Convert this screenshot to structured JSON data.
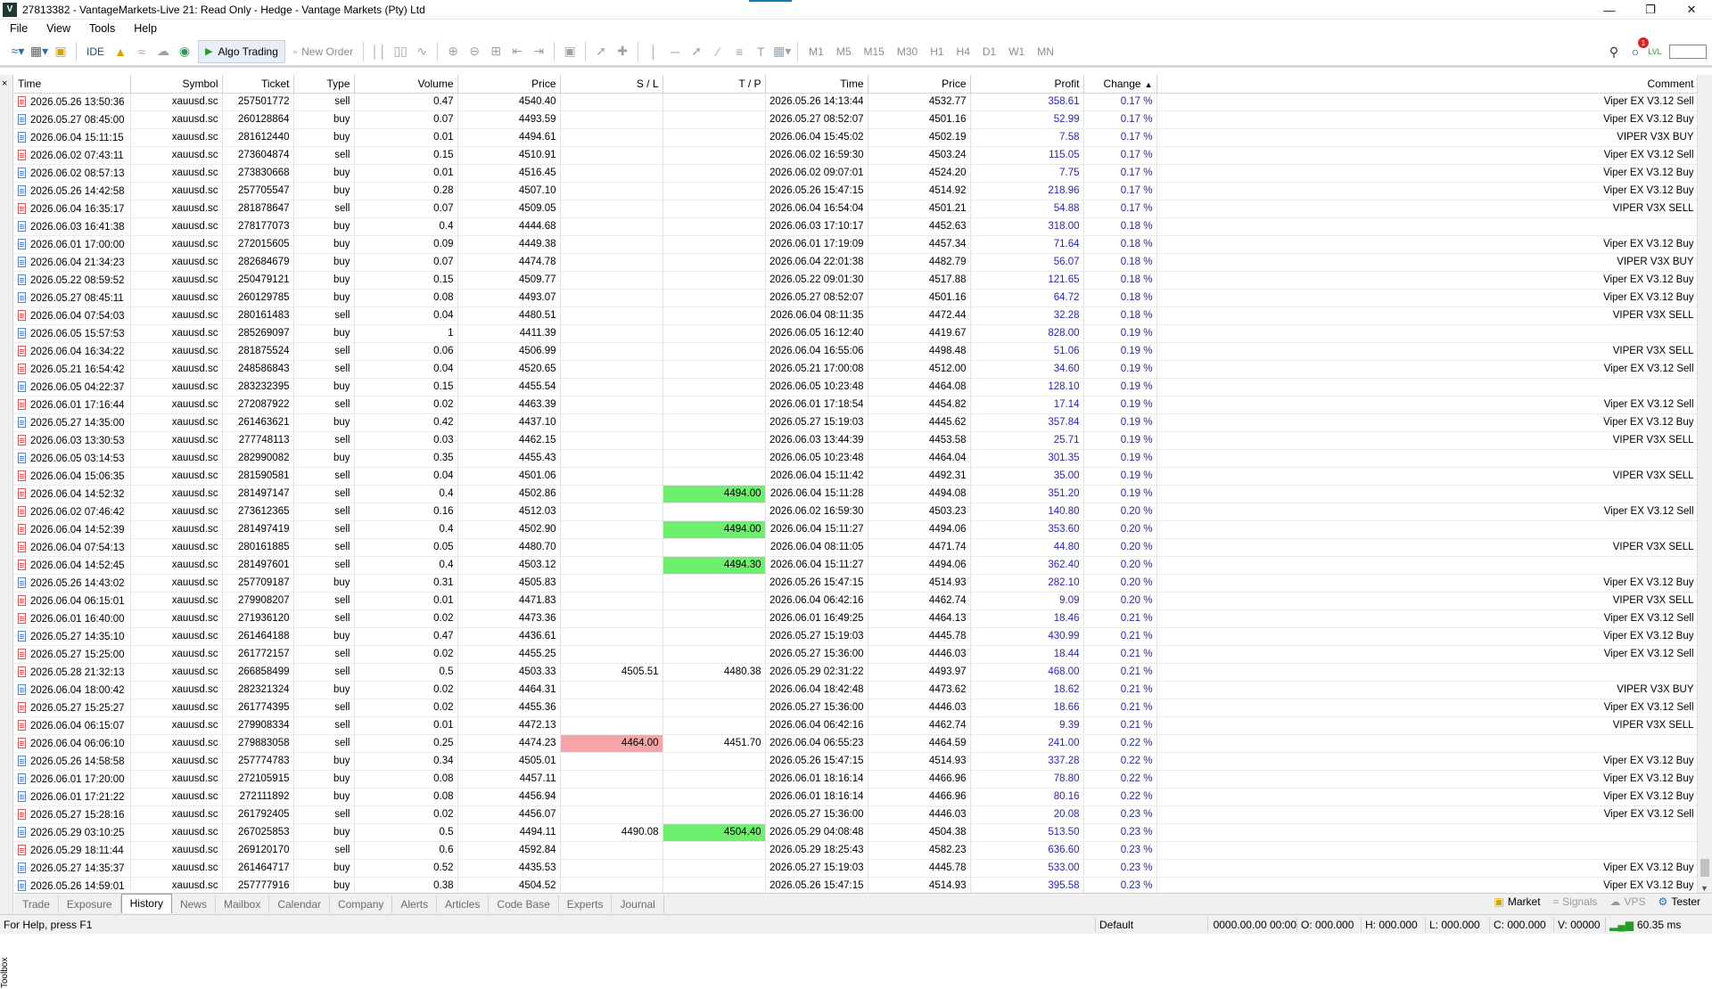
{
  "window": {
    "title": "27813382 - VantageMarkets-Live 21: Read Only - Hedge - Vantage Markets (Pty) Ltd",
    "app_icon": "V"
  },
  "menu": [
    "File",
    "View",
    "Tools",
    "Help"
  ],
  "toolbar": {
    "ide_label": "IDE",
    "algo_trading_label": "Algo Trading",
    "new_order_label": "New Order",
    "timeframes": [
      "M1",
      "M5",
      "M15",
      "M30",
      "H1",
      "H4",
      "D1",
      "W1",
      "MN"
    ],
    "notification_count": "1",
    "lvl_label": "LVL"
  },
  "toolbox": {
    "label": "Toolbox",
    "close": "×"
  },
  "table": {
    "columns": [
      "Time",
      "Symbol",
      "Ticket",
      "Type",
      "Volume",
      "Price",
      "S / L",
      "T / P",
      "Time",
      "Price",
      "Profit",
      "Change",
      "Comment"
    ],
    "sort_indicator": "▲",
    "rows": [
      [
        "2026.05.26 13:50:36",
        "xauusd.sc",
        "257501772",
        "sell",
        "0.47",
        "4540.40",
        "",
        "",
        "2026.05.26 14:13:44",
        "4532.77",
        "358.61",
        "0.17 %",
        "Viper EX V3.12 Sell"
      ],
      [
        "2026.05.27 08:45:00",
        "xauusd.sc",
        "260128864",
        "buy",
        "0.07",
        "4493.59",
        "",
        "",
        "2026.05.27 08:52:07",
        "4501.16",
        "52.99",
        "0.17 %",
        "Viper EX V3.12 Buy"
      ],
      [
        "2026.06.04 15:11:15",
        "xauusd.sc",
        "281612440",
        "buy",
        "0.01",
        "4494.61",
        "",
        "",
        "2026.06.04 15:45:02",
        "4502.19",
        "7.58",
        "0.17 %",
        "VIPER V3X BUY"
      ],
      [
        "2026.06.02 07:43:11",
        "xauusd.sc",
        "273604874",
        "sell",
        "0.15",
        "4510.91",
        "",
        "",
        "2026.06.02 16:59:30",
        "4503.24",
        "115.05",
        "0.17 %",
        "Viper EX V3.12 Sell"
      ],
      [
        "2026.06.02 08:57:13",
        "xauusd.sc",
        "273830668",
        "buy",
        "0.01",
        "4516.45",
        "",
        "",
        "2026.06.02 09:07:01",
        "4524.20",
        "7.75",
        "0.17 %",
        "Viper EX V3.12 Buy"
      ],
      [
        "2026.05.26 14:42:58",
        "xauusd.sc",
        "257705547",
        "buy",
        "0.28",
        "4507.10",
        "",
        "",
        "2026.05.26 15:47:15",
        "4514.92",
        "218.96",
        "0.17 %",
        "Viper EX V3.12 Buy"
      ],
      [
        "2026.06.04 16:35:17",
        "xauusd.sc",
        "281878647",
        "sell",
        "0.07",
        "4509.05",
        "",
        "",
        "2026.06.04 16:54:04",
        "4501.21",
        "54.88",
        "0.17 %",
        "VIPER V3X SELL"
      ],
      [
        "2026.06.03 16:41:38",
        "xauusd.sc",
        "278177073",
        "buy",
        "0.4",
        "4444.68",
        "",
        "",
        "2026.06.03 17:10:17",
        "4452.63",
        "318.00",
        "0.18 %",
        ""
      ],
      [
        "2026.06.01 17:00:00",
        "xauusd.sc",
        "272015605",
        "buy",
        "0.09",
        "4449.38",
        "",
        "",
        "2026.06.01 17:19:09",
        "4457.34",
        "71.64",
        "0.18 %",
        "Viper EX V3.12 Buy"
      ],
      [
        "2026.06.04 21:34:23",
        "xauusd.sc",
        "282684679",
        "buy",
        "0.07",
        "4474.78",
        "",
        "",
        "2026.06.04 22:01:38",
        "4482.79",
        "56.07",
        "0.18 %",
        "VIPER V3X BUY"
      ],
      [
        "2026.05.22 08:59:52",
        "xauusd.sc",
        "250479121",
        "buy",
        "0.15",
        "4509.77",
        "",
        "",
        "2026.05.22 09:01:30",
        "4517.88",
        "121.65",
        "0.18 %",
        "Viper EX V3.12 Buy"
      ],
      [
        "2026.05.27 08:45:11",
        "xauusd.sc",
        "260129785",
        "buy",
        "0.08",
        "4493.07",
        "",
        "",
        "2026.05.27 08:52:07",
        "4501.16",
        "64.72",
        "0.18 %",
        "Viper EX V3.12 Buy"
      ],
      [
        "2026.06.04 07:54:03",
        "xauusd.sc",
        "280161483",
        "sell",
        "0.04",
        "4480.51",
        "",
        "",
        "2026.06.04 08:11:35",
        "4472.44",
        "32.28",
        "0.18 %",
        "VIPER V3X SELL"
      ],
      [
        "2026.06.05 15:57:53",
        "xauusd.sc",
        "285269097",
        "buy",
        "1",
        "4411.39",
        "",
        "",
        "2026.06.05 16:12:40",
        "4419.67",
        "828.00",
        "0.19 %",
        ""
      ],
      [
        "2026.06.04 16:34:22",
        "xauusd.sc",
        "281875524",
        "sell",
        "0.06",
        "4506.99",
        "",
        "",
        "2026.06.04 16:55:06",
        "4498.48",
        "51.06",
        "0.19 %",
        "VIPER V3X SELL"
      ],
      [
        "2026.05.21 16:54:42",
        "xauusd.sc",
        "248586843",
        "sell",
        "0.04",
        "4520.65",
        "",
        "",
        "2026.05.21 17:00:08",
        "4512.00",
        "34.60",
        "0.19 %",
        "Viper EX V3.12 Sell"
      ],
      [
        "2026.06.05 04:22:37",
        "xauusd.sc",
        "283232395",
        "buy",
        "0.15",
        "4455.54",
        "",
        "",
        "2026.06.05 10:23:48",
        "4464.08",
        "128.10",
        "0.19 %",
        ""
      ],
      [
        "2026.06.01 17:16:44",
        "xauusd.sc",
        "272087922",
        "sell",
        "0.02",
        "4463.39",
        "",
        "",
        "2026.06.01 17:18:54",
        "4454.82",
        "17.14",
        "0.19 %",
        "Viper EX V3.12 Sell"
      ],
      [
        "2026.05.27 14:35:00",
        "xauusd.sc",
        "261463621",
        "buy",
        "0.42",
        "4437.10",
        "",
        "",
        "2026.05.27 15:19:03",
        "4445.62",
        "357.84",
        "0.19 %",
        "Viper EX V3.12 Buy"
      ],
      [
        "2026.06.03 13:30:53",
        "xauusd.sc",
        "277748113",
        "sell",
        "0.03",
        "4462.15",
        "",
        "",
        "2026.06.03 13:44:39",
        "4453.58",
        "25.71",
        "0.19 %",
        "VIPER V3X SELL"
      ],
      [
        "2026.06.05 03:14:53",
        "xauusd.sc",
        "282990082",
        "buy",
        "0.35",
        "4455.43",
        "",
        "",
        "2026.06.05 10:23:48",
        "4464.04",
        "301.35",
        "0.19 %",
        ""
      ],
      [
        "2026.06.04 15:06:35",
        "xauusd.sc",
        "281590581",
        "sell",
        "0.04",
        "4501.06",
        "",
        "",
        "2026.06.04 15:11:42",
        "4492.31",
        "35.00",
        "0.19 %",
        "VIPER V3X SELL"
      ],
      [
        "2026.06.04 14:52:32",
        "xauusd.sc",
        "281497147",
        "sell",
        "0.4",
        "4502.86",
        "",
        "4494.00",
        "2026.06.04 15:11:28",
        "4494.08",
        "351.20",
        "0.19 %",
        ""
      ],
      [
        "2026.06.02 07:46:42",
        "xauusd.sc",
        "273612365",
        "sell",
        "0.16",
        "4512.03",
        "",
        "",
        "2026.06.02 16:59:30",
        "4503.23",
        "140.80",
        "0.20 %",
        "Viper EX V3.12 Sell"
      ],
      [
        "2026.06.04 14:52:39",
        "xauusd.sc",
        "281497419",
        "sell",
        "0.4",
        "4502.90",
        "",
        "4494.00",
        "2026.06.04 15:11:27",
        "4494.06",
        "353.60",
        "0.20 %",
        ""
      ],
      [
        "2026.06.04 07:54:13",
        "xauusd.sc",
        "280161885",
        "sell",
        "0.05",
        "4480.70",
        "",
        "",
        "2026.06.04 08:11:05",
        "4471.74",
        "44.80",
        "0.20 %",
        "VIPER V3X SELL"
      ],
      [
        "2026.06.04 14:52:45",
        "xauusd.sc",
        "281497601",
        "sell",
        "0.4",
        "4503.12",
        "",
        "4494.30",
        "2026.06.04 15:11:27",
        "4494.06",
        "362.40",
        "0.20 %",
        ""
      ],
      [
        "2026.05.26 14:43:02",
        "xauusd.sc",
        "257709187",
        "buy",
        "0.31",
        "4505.83",
        "",
        "",
        "2026.05.26 15:47:15",
        "4514.93",
        "282.10",
        "0.20 %",
        "Viper EX V3.12 Buy"
      ],
      [
        "2026.06.04 06:15:01",
        "xauusd.sc",
        "279908207",
        "sell",
        "0.01",
        "4471.83",
        "",
        "",
        "2026.06.04 06:42:16",
        "4462.74",
        "9.09",
        "0.20 %",
        "VIPER V3X SELL"
      ],
      [
        "2026.06.01 16:40:00",
        "xauusd.sc",
        "271936120",
        "sell",
        "0.02",
        "4473.36",
        "",
        "",
        "2026.06.01 16:49:25",
        "4464.13",
        "18.46",
        "0.21 %",
        "Viper EX V3.12 Sell"
      ],
      [
        "2026.05.27 14:35:10",
        "xauusd.sc",
        "261464188",
        "buy",
        "0.47",
        "4436.61",
        "",
        "",
        "2026.05.27 15:19:03",
        "4445.78",
        "430.99",
        "0.21 %",
        "Viper EX V3.12 Buy"
      ],
      [
        "2026.05.27 15:25:00",
        "xauusd.sc",
        "261772157",
        "sell",
        "0.02",
        "4455.25",
        "",
        "",
        "2026.05.27 15:36:00",
        "4446.03",
        "18.44",
        "0.21 %",
        "Viper EX V3.12 Sell"
      ],
      [
        "2026.05.28 21:32:13",
        "xauusd.sc",
        "266858499",
        "sell",
        "0.5",
        "4503.33",
        "4505.51",
        "4480.38",
        "2026.05.29 02:31:22",
        "4493.97",
        "468.00",
        "0.21 %",
        ""
      ],
      [
        "2026.06.04 18:00:42",
        "xauusd.sc",
        "282321324",
        "buy",
        "0.02",
        "4464.31",
        "",
        "",
        "2026.06.04 18:42:48",
        "4473.62",
        "18.62",
        "0.21 %",
        "VIPER V3X BUY"
      ],
      [
        "2026.05.27 15:25:27",
        "xauusd.sc",
        "261774395",
        "sell",
        "0.02",
        "4455.36",
        "",
        "",
        "2026.05.27 15:36:00",
        "4446.03",
        "18.66",
        "0.21 %",
        "Viper EX V3.12 Sell"
      ],
      [
        "2026.06.04 06:15:07",
        "xauusd.sc",
        "279908334",
        "sell",
        "0.01",
        "4472.13",
        "",
        "",
        "2026.06.04 06:42:16",
        "4462.74",
        "9.39",
        "0.21 %",
        "VIPER V3X SELL"
      ],
      [
        "2026.06.04 06:06:10",
        "xauusd.sc",
        "279883058",
        "sell",
        "0.25",
        "4474.23",
        "4464.00",
        "4451.70",
        "2026.06.04 06:55:23",
        "4464.59",
        "241.00",
        "0.22 %",
        ""
      ],
      [
        "2026.05.26 14:58:58",
        "xauusd.sc",
        "257774783",
        "buy",
        "0.34",
        "4505.01",
        "",
        "",
        "2026.05.26 15:47:15",
        "4514.93",
        "337.28",
        "0.22 %",
        "Viper EX V3.12 Buy"
      ],
      [
        "2026.06.01 17:20:00",
        "xauusd.sc",
        "272105915",
        "buy",
        "0.08",
        "4457.11",
        "",
        "",
        "2026.06.01 18:16:14",
        "4466.96",
        "78.80",
        "0.22 %",
        "Viper EX V3.12 Buy"
      ],
      [
        "2026.06.01 17:21:22",
        "xauusd.sc",
        "272111892",
        "buy",
        "0.08",
        "4456.94",
        "",
        "",
        "2026.06.01 18:16:14",
        "4466.96",
        "80.16",
        "0.22 %",
        "Viper EX V3.12 Buy"
      ],
      [
        "2026.05.27 15:28:16",
        "xauusd.sc",
        "261792405",
        "sell",
        "0.02",
        "4456.07",
        "",
        "",
        "2026.05.27 15:36:00",
        "4446.03",
        "20.08",
        "0.23 %",
        "Viper EX V3.12 Sell"
      ],
      [
        "2026.05.29 03:10:25",
        "xauusd.sc",
        "267025853",
        "buy",
        "0.5",
        "4494.11",
        "4490.08",
        "4504.40",
        "2026.05.29 04:08:48",
        "4504.38",
        "513.50",
        "0.23 %",
        ""
      ],
      [
        "2026.05.29 18:11:44",
        "xauusd.sc",
        "269120170",
        "sell",
        "0.6",
        "4592.84",
        "",
        "",
        "2026.05.29 18:25:43",
        "4582.23",
        "636.60",
        "0.23 %",
        ""
      ],
      [
        "2026.05.27 14:35:37",
        "xauusd.sc",
        "261464717",
        "buy",
        "0.52",
        "4435.53",
        "",
        "",
        "2026.05.27 15:19:03",
        "4445.78",
        "533.00",
        "0.23 %",
        "Viper EX V3.12 Buy"
      ],
      [
        "2026.05.26 14:59:01",
        "xauusd.sc",
        "257777916",
        "buy",
        "0.38",
        "4504.52",
        "",
        "",
        "2026.05.26 15:47:15",
        "4514.93",
        "395.58",
        "0.23 %",
        "Viper EX V3.12 Buy"
      ]
    ],
    "highlights": {
      "green_tp_rows": [
        22,
        24,
        26,
        41
      ],
      "red_sl_rows": [
        36
      ]
    }
  },
  "bottom_tabs": [
    "Trade",
    "Exposure",
    "History",
    "News",
    "Mailbox",
    "Calendar",
    "Company",
    "Alerts",
    "Articles",
    "Code Base",
    "Experts",
    "Journal"
  ],
  "active_tab": "History",
  "bottom_right": {
    "market": "Market",
    "signals": "Signals",
    "vps": "VPS",
    "tester": "Tester"
  },
  "status": {
    "help": "For Help, press F1",
    "profile": "Default",
    "datetime": "0000.00.00 00:00",
    "open": "O: 000.000",
    "high": "H: 000.000",
    "low": "L: 000.000",
    "close": "C: 000.000",
    "volume": "V: 00000",
    "ping": "60.35 ms"
  },
  "colors": {
    "profit_blue": "#2727b0",
    "tp_green": "#6ef06e",
    "sl_red": "#f6a4a8"
  }
}
